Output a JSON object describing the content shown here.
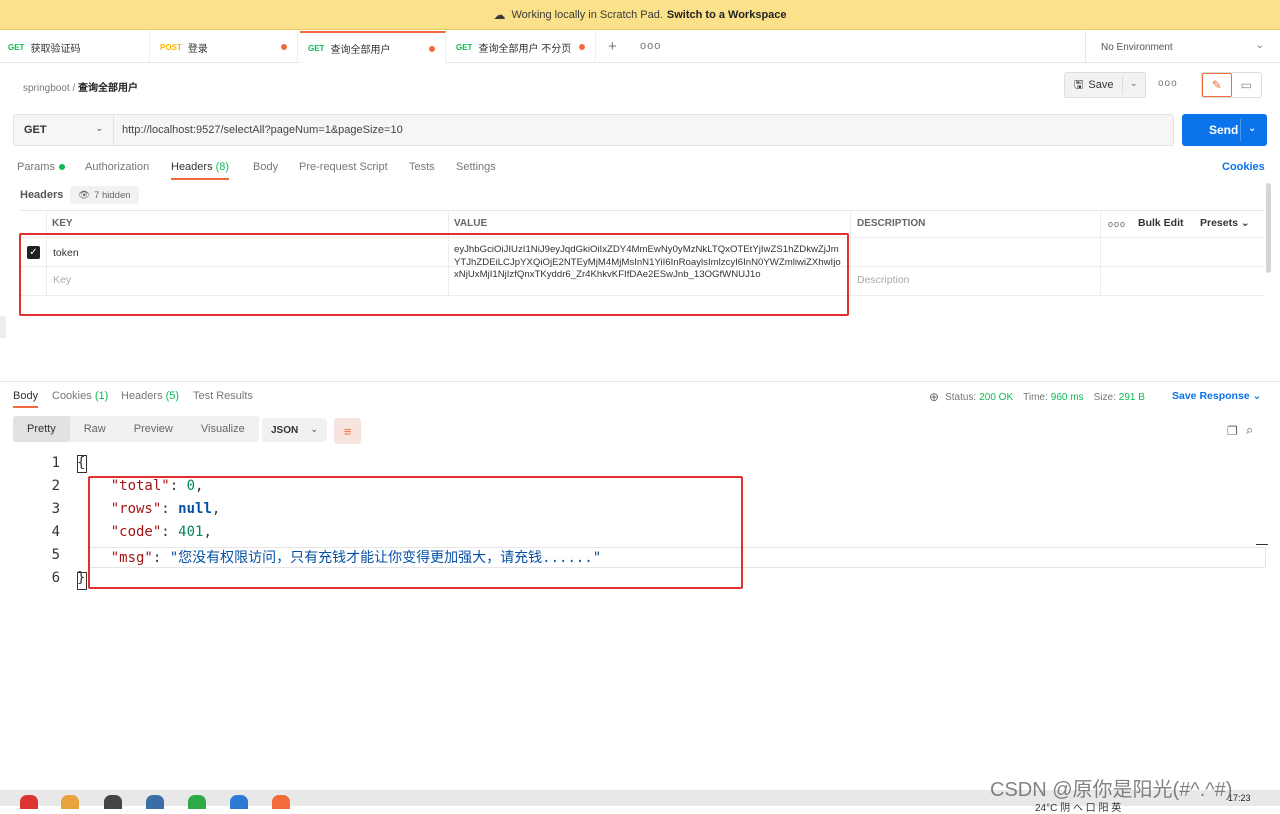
{
  "banner": {
    "text": "Working locally in Scratch Pad.",
    "link": "Switch to a Workspace"
  },
  "tabs": [
    {
      "method": "GET",
      "label": "获取验证码"
    },
    {
      "method": "POST",
      "label": "登录"
    },
    {
      "method": "GET",
      "label": "查询全部用户"
    },
    {
      "method": "GET",
      "label": "查询全部用户 不分页"
    }
  ],
  "environment": "No Environment",
  "breadcrumb": {
    "collection": "springboot",
    "separator": "/",
    "request": "查询全部用户"
  },
  "actions": {
    "save": "Save",
    "more": "ooo"
  },
  "request": {
    "method": "GET",
    "url": "http://localhost:9527/selectAll?pageNum=1&pageSize=10",
    "send": "Send"
  },
  "request_tabs": {
    "params": "Params",
    "authorization": "Authorization",
    "headers": "Headers",
    "headers_count": "(8)",
    "body": "Body",
    "prerequest": "Pre-request Script",
    "tests": "Tests",
    "settings": "Settings",
    "cookies": "Cookies"
  },
  "headers_section": {
    "label": "Headers",
    "hidden": "7 hidden"
  },
  "headers_table": {
    "columns": [
      "KEY",
      "VALUE",
      "DESCRIPTION"
    ],
    "bulk_edit": "Bulk Edit",
    "presets": "Presets",
    "rows": [
      {
        "key": "token",
        "value": "eyJhbGciOiJIUzI1NiJ9eyJqdGkiOiIxZDY4MmEwNy0yMzNkLTQxOTEtYjIwZS1hZDkwZjJmYTJhZDEiLCJpYXQiOjE2NTEyMjM4MjMsInN1YiI6InRoaylsImlzcyI6InN0YWZmliwiZXhwIjoxNjUxMjI1NjIzfQnxTKyddr6_Zr4KhkvKFIfDAe2ESwJnb_13OGfWNUJ1o",
        "checked": true
      }
    ],
    "placeholder_key": "Key",
    "placeholder_description": "Description"
  },
  "response_tabs": {
    "body": "Body",
    "cookies": "Cookies",
    "cookies_count": "(1)",
    "headers": "Headers",
    "headers_count": "(5)",
    "tests": "Test Results"
  },
  "response_meta": {
    "status_label": "Status:",
    "status": "200 OK",
    "time_label": "Time:",
    "time": "960 ms",
    "size_label": "Size:",
    "size": "291 B",
    "save_response": "Save Response"
  },
  "view_tabs": [
    "Pretty",
    "Raw",
    "Preview",
    "Visualize"
  ],
  "format": "JSON",
  "code_lines": [
    "1",
    "2",
    "3",
    "4",
    "5",
    "6"
  ],
  "response_body": {
    "total_key": "\"total\"",
    "total_val": "0",
    "rows_key": "\"rows\"",
    "rows_val": "null",
    "code_key": "\"code\"",
    "code_val": "401",
    "msg_key": "\"msg\"",
    "msg_val": "\"您没有权限访问，只有充钱才能让你变得更加强大，请充钱......\""
  },
  "taskbar": {
    "clock": "17:23",
    "tray": "24°C 阴 へ 口 阳 英"
  },
  "watermark": "CSDN @原你是阳光(#^.^#)",
  "colors": {
    "accent": "#f26b3a",
    "primary": "#0b74ea",
    "success": "#0cbb52",
    "highlight": "#e0302e",
    "banner": "#fbe28a"
  }
}
